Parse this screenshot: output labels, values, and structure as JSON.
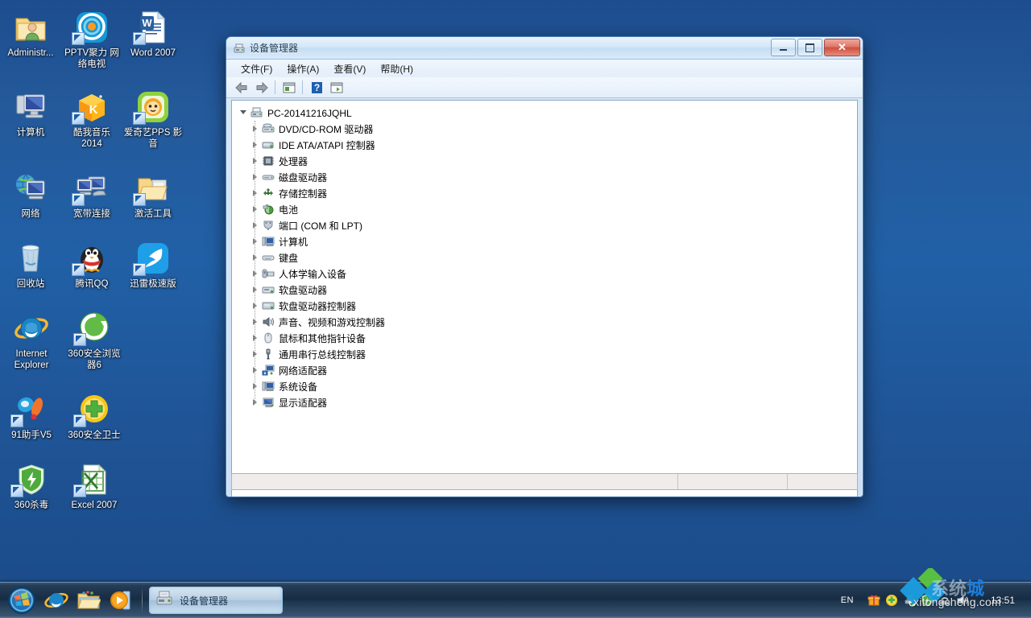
{
  "desktop": {
    "icons": [
      {
        "label": "Administr...",
        "name": "desktop-icon-administrator",
        "art": "user-folder",
        "shortcut": false
      },
      {
        "label": "PPTV聚力 网络电视",
        "name": "desktop-icon-pptv",
        "art": "pptv",
        "shortcut": true
      },
      {
        "label": "Word 2007",
        "name": "desktop-icon-word-2007",
        "art": "word",
        "shortcut": true
      },
      {
        "label": "计算机",
        "name": "desktop-icon-computer",
        "art": "computer",
        "shortcut": false
      },
      {
        "label": "酷我音乐 2014",
        "name": "desktop-icon-kuwo-music",
        "art": "kuwo",
        "shortcut": true
      },
      {
        "label": "爱奇艺PPS 影音",
        "name": "desktop-icon-iqiyi-pps",
        "art": "pps",
        "shortcut": true
      },
      {
        "label": "网络",
        "name": "desktop-icon-network",
        "art": "network",
        "shortcut": false
      },
      {
        "label": "宽带连接",
        "name": "desktop-icon-broadband",
        "art": "broadband",
        "shortcut": true
      },
      {
        "label": "激活工具",
        "name": "desktop-icon-activation-tool",
        "art": "folder-open",
        "shortcut": true
      },
      {
        "label": "回收站",
        "name": "desktop-icon-recycle-bin",
        "art": "recycle-bin",
        "shortcut": false
      },
      {
        "label": "腾讯QQ",
        "name": "desktop-icon-tencent-qq",
        "art": "qq",
        "shortcut": true
      },
      {
        "label": "迅雷极速版",
        "name": "desktop-icon-xunlei",
        "art": "xunlei",
        "shortcut": true
      },
      {
        "label": "Internet Explorer",
        "name": "desktop-icon-internet-explorer",
        "art": "ie",
        "shortcut": false
      },
      {
        "label": "360安全浏览器6",
        "name": "desktop-icon-360-browser",
        "art": "browser360",
        "shortcut": true
      },
      {
        "label": "91助手V5",
        "name": "desktop-icon-91-assistant",
        "art": "assistant91",
        "shortcut": true
      },
      {
        "label": "360安全卫士",
        "name": "desktop-icon-360-safe",
        "art": "safe360",
        "shortcut": true
      },
      {
        "label": "360杀毒",
        "name": "desktop-icon-360-antivirus",
        "art": "av360",
        "shortcut": true
      },
      {
        "label": "Excel 2007",
        "name": "desktop-icon-excel-2007",
        "art": "excel",
        "shortcut": true
      }
    ]
  },
  "window": {
    "title": "设备管理器",
    "title_icon": "device-manager-icon",
    "caption": {
      "minimize": "最小化",
      "maximize": "最大化",
      "close": "✕"
    },
    "menu": [
      {
        "label": "文件(F)",
        "name": "menu-file"
      },
      {
        "label": "操作(A)",
        "name": "menu-action"
      },
      {
        "label": "查看(V)",
        "name": "menu-view"
      },
      {
        "label": "帮助(H)",
        "name": "menu-help"
      }
    ],
    "toolbar": [
      {
        "name": "back-button",
        "icon": "arrow-left-icon"
      },
      {
        "name": "forward-button",
        "icon": "arrow-right-icon"
      },
      {
        "name": "separator-1",
        "icon": "separator"
      },
      {
        "name": "show-hide-console-tree-button",
        "icon": "console-tree-icon"
      },
      {
        "name": "separator-2",
        "icon": "separator"
      },
      {
        "name": "help-button",
        "icon": "question-mark-icon"
      },
      {
        "name": "properties-button",
        "icon": "properties-icon"
      }
    ],
    "statusbar": {
      "pane1": "",
      "pane2": "",
      "pane3": ""
    }
  },
  "tree": {
    "root": {
      "label": "PC-20141216JQHL",
      "icon": "computer-node-icon",
      "expanded": true
    },
    "nodes": [
      {
        "label": "DVD/CD-ROM 驱动器",
        "icon": "dvd-drive-icon"
      },
      {
        "label": "IDE ATA/ATAPI 控制器",
        "icon": "ide-controller-icon"
      },
      {
        "label": "处理器",
        "icon": "processor-icon"
      },
      {
        "label": "磁盘驱动器",
        "icon": "disk-drive-icon"
      },
      {
        "label": "存储控制器",
        "icon": "storage-controller-icon"
      },
      {
        "label": "电池",
        "icon": "battery-icon"
      },
      {
        "label": "端口 (COM 和 LPT)",
        "icon": "port-icon"
      },
      {
        "label": "计算机",
        "icon": "computer-icon"
      },
      {
        "label": "键盘",
        "icon": "keyboard-icon"
      },
      {
        "label": "人体学输入设备",
        "icon": "hid-icon"
      },
      {
        "label": "软盘驱动器",
        "icon": "floppy-drive-icon"
      },
      {
        "label": "软盘驱动器控制器",
        "icon": "floppy-controller-icon"
      },
      {
        "label": "声音、视频和游戏控制器",
        "icon": "sound-video-game-icon"
      },
      {
        "label": "鼠标和其他指针设备",
        "icon": "mouse-icon"
      },
      {
        "label": "通用串行总线控制器",
        "icon": "usb-controller-icon"
      },
      {
        "label": "网络适配器",
        "icon": "network-adapter-icon"
      },
      {
        "label": "系统设备",
        "icon": "system-device-icon"
      },
      {
        "label": "显示适配器",
        "icon": "display-adapter-icon"
      }
    ]
  },
  "taskbar": {
    "start_button": "start-orb",
    "quick_launch": [
      {
        "name": "quicklaunch-internet-explorer",
        "icon": "ie-icon"
      },
      {
        "name": "quicklaunch-windows-explorer",
        "icon": "folder-icon"
      },
      {
        "name": "quicklaunch-media-player",
        "icon": "media-player-icon"
      }
    ],
    "tasks": [
      {
        "label": "设备管理器",
        "name": "taskbar-button-device-manager",
        "icon": "device-manager-icon",
        "active": true
      }
    ],
    "tray": {
      "language": "EN",
      "icons": [
        {
          "name": "tray-icon-gift",
          "icon": "gift-icon"
        },
        {
          "name": "tray-icon-360-safe",
          "icon": "360-safe-icon"
        },
        {
          "name": "tray-icon-safe-eject",
          "icon": "safely-remove-hardware-icon"
        },
        {
          "name": "tray-icon-360-shield",
          "icon": "360-shield-icon"
        },
        {
          "name": "tray-icon-network",
          "icon": "network-icon"
        },
        {
          "name": "tray-icon-volume",
          "icon": "volume-icon"
        }
      ],
      "clock": "13:51"
    }
  },
  "watermark": {
    "site": "xitongcheng.com",
    "cn_part1": "系统",
    "cn_part2": "城"
  }
}
